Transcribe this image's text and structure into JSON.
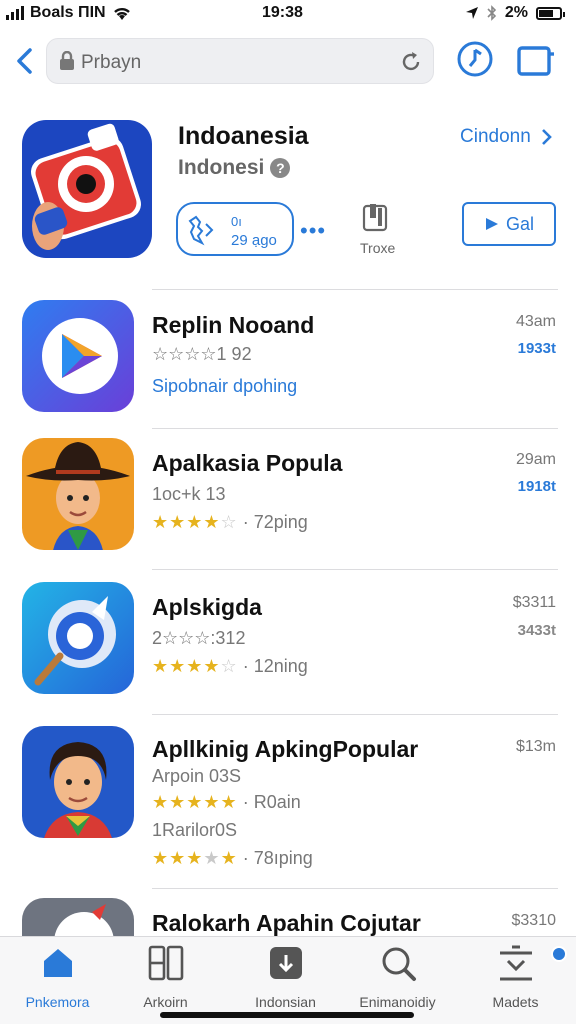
{
  "status": {
    "carrier": "Boals ΠΙΝ",
    "time": "19:38",
    "battery": "2%"
  },
  "browser": {
    "url": "Prbayn"
  },
  "featured": {
    "title": "Indoanesia",
    "subtitle": "Indonesi",
    "link": "Cindonn",
    "pill_top": "0ı",
    "pill_bottom": "29 ạgo",
    "size_label": "Troxe",
    "get_label": "Gal"
  },
  "apps": [
    {
      "title": "Replin Nooand",
      "line1": "☆☆☆☆1 92",
      "line2": "Sipobnair dpohing",
      "time": "43am",
      "badge": "1933t"
    },
    {
      "title": "Apalkasia Popula",
      "line1": "1oc+k 13",
      "rating": "72ping",
      "stars": 3.5,
      "time": "29am",
      "badge": "1918t"
    },
    {
      "title": "Aplskigda",
      "line1": "2☆☆☆:312",
      "rating": "12ning",
      "stars": 4,
      "time": "$3311",
      "badge": "3433t"
    },
    {
      "title": "Apllkinig ApkingPopular",
      "line1": "Arpoin 03S",
      "rating": "R0ain",
      "rating2_label": "1Rarilor0S",
      "rating2": "78ıping",
      "stars": 5,
      "stars2": 3.5,
      "time": "$13m"
    },
    {
      "title": "Ralokarh Apahin Cojutar",
      "time": "$3310"
    }
  ],
  "tabs": [
    {
      "label": "Pnkemora",
      "icon": "home-icon"
    },
    {
      "label": "Arkoirn",
      "icon": "grid-icon"
    },
    {
      "label": "Indonsian",
      "icon": "download-icon"
    },
    {
      "label": "Enimanoidiy",
      "icon": "search-icon"
    },
    {
      "label": "Madets",
      "icon": "updates-icon"
    }
  ],
  "colors": {
    "accent": "#2a7ad8",
    "star": "#e6b31e"
  }
}
